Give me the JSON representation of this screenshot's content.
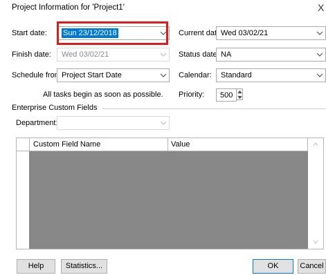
{
  "dialog": {
    "title": "Project Information for 'Project1'",
    "close_glyph": "X"
  },
  "fields": {
    "start_date": {
      "label": "Start date:",
      "value": "Sun 23/12/2018"
    },
    "finish_date": {
      "label": "Finish date:",
      "value": "Wed 03/02/21"
    },
    "schedule_from": {
      "label": "Schedule from:",
      "value": "Project Start Date"
    },
    "schedule_note": "All tasks begin as soon as possible.",
    "current_date": {
      "label": "Current date:",
      "value": "Wed 03/02/21"
    },
    "status_date": {
      "label": "Status date:",
      "value": "NA"
    },
    "calendar": {
      "label": "Calendar:",
      "value": "Standard"
    },
    "priority": {
      "label": "Priority:",
      "value": "500"
    }
  },
  "enterprise": {
    "heading": "Enterprise Custom Fields",
    "department_label": "Department:",
    "department_value": ""
  },
  "grid": {
    "columns": [
      "Custom Field Name",
      "Value"
    ]
  },
  "buttons": {
    "help": "Help",
    "statistics": "Statistics...",
    "ok": "OK",
    "cancel": "Cancel"
  },
  "colors": {
    "highlight_border": "#e01b1b",
    "selection": "#0078d7",
    "grid_body": "#888888"
  }
}
